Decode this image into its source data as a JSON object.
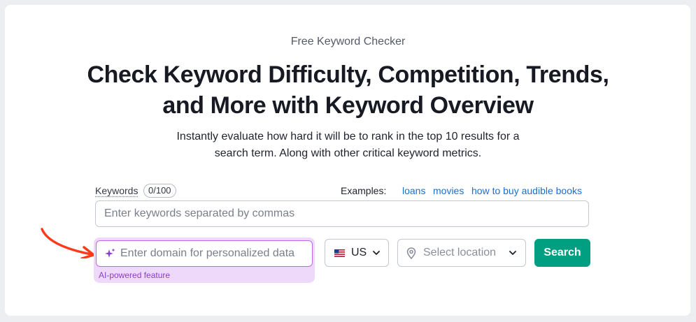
{
  "header": {
    "eyebrow": "Free Keyword Checker",
    "headline_line1": "Check Keyword Difficulty, Competition, Trends,",
    "headline_line2": "and More with Keyword Overview",
    "subtitle_line1": "Instantly evaluate how hard it will be to rank in the top 10 results for a",
    "subtitle_line2": "search term. Along with other critical keyword metrics."
  },
  "keywords": {
    "label": "Keywords",
    "counter": "0/100",
    "placeholder": "Enter keywords separated by commas",
    "value": ""
  },
  "examples": {
    "label": "Examples:",
    "links": [
      "loans",
      "movies",
      "how to buy audible books"
    ]
  },
  "domain": {
    "placeholder": "Enter domain for personalized data",
    "ai_note": "AI-powered feature",
    "icon": "sparkle-icon"
  },
  "country": {
    "selected": "US",
    "icon": "us-flag-icon"
  },
  "location": {
    "placeholder": "Select location",
    "icon": "map-pin-icon"
  },
  "search": {
    "label": "Search"
  },
  "colors": {
    "accent": "#009f81",
    "link": "#1a6fd0",
    "ai_purple": "#8a3fc4",
    "ai_bg": "#efd9fb",
    "arrow": "#ff3a1a"
  }
}
